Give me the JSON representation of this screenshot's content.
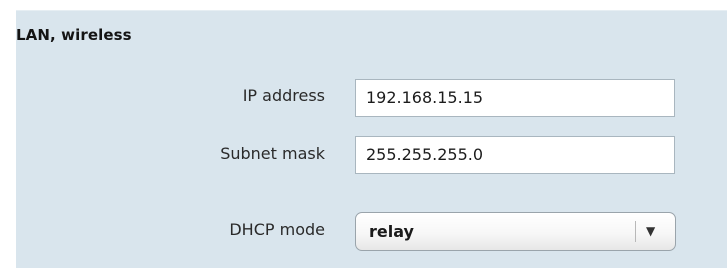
{
  "section": {
    "title": "LAN, wireless"
  },
  "fields": {
    "ip_address": {
      "label": "IP address",
      "value": "192.168.15.15"
    },
    "subnet_mask": {
      "label": "Subnet mask",
      "value": "255.255.255.0"
    },
    "dhcp_mode": {
      "label": "DHCP mode",
      "value": "relay",
      "arrow": "▼"
    }
  },
  "colors": {
    "panel_background": "#d9e5ed",
    "field_border": "#a9b6bf"
  },
  "icons": {
    "dropdown": "chevron-down-icon"
  }
}
